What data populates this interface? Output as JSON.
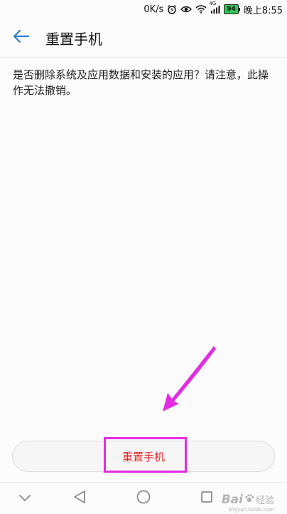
{
  "status_bar": {
    "network_speed": "0K/s",
    "signal_type": "4G",
    "battery_level": "94",
    "time": "晚上8:55",
    "icons": [
      "alarm-icon",
      "eye-comfort-icon",
      "wifi-icon",
      "cell-signal-icon",
      "battery-icon"
    ]
  },
  "app_bar": {
    "title": "重置手机",
    "back_icon": "back-arrow-icon"
  },
  "content": {
    "description": "是否删除系统及应用数据和安装的应用？请注意，此操作无法撤销。"
  },
  "actions": {
    "reset_label": "重置手机",
    "reset_color": "#e2272b"
  },
  "annotation": {
    "highlight_color": "#e32ce3"
  },
  "nav_bar": {
    "buttons": [
      "chevron-down-icon",
      "back-triangle-icon",
      "home-circle-icon",
      "recents-square-icon"
    ]
  },
  "watermark": {
    "brand": "Bai",
    "sub": "经验",
    "url": "jingyan.baidu.com"
  }
}
